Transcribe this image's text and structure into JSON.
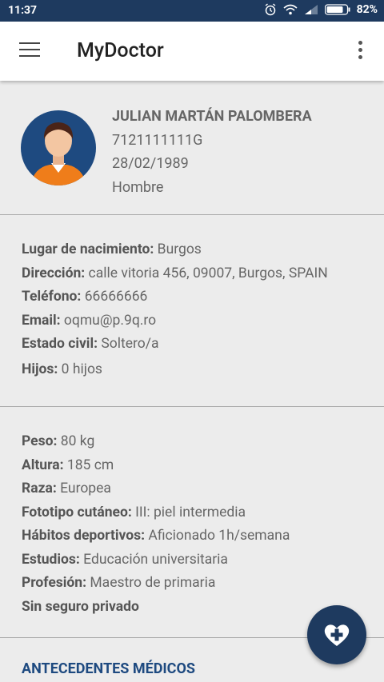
{
  "status_bar": {
    "time": "11:37",
    "battery": "82%"
  },
  "app_bar": {
    "title": "MyDoctor"
  },
  "profile": {
    "name": "JULIAN MARTÁN PALOMBERA",
    "id": "7121111111G",
    "birthdate": "28/02/1989",
    "gender": "Hombre"
  },
  "personal": {
    "birthplace_label": "Lugar de nacimiento:",
    "birthplace_value": " Burgos",
    "address_label": "Dirección:",
    "address_value": " calle vitoria 456, 09007, Burgos, SPAIN",
    "phone_label": "Teléfono:",
    "phone_value": " 66666666",
    "email_label": "Email:",
    "email_value": " oqmu@p.9q.ro",
    "civil_label": "Estado civil:",
    "civil_value": " Soltero/a",
    "children_label": "Hijos:",
    "children_value": " 0 hijos"
  },
  "health": {
    "weight_label": "Peso:",
    "weight_value": " 80 kg",
    "height_label": "Altura:",
    "height_value": " 185 cm",
    "race_label": "Raza:",
    "race_value": " Europea",
    "phototype_label": "Fototipo cutáneo:",
    "phototype_value": " III: piel intermedia",
    "sports_label": "Hábitos deportivos:",
    "sports_value": " Aficionado 1h/semana",
    "studies_label": "Estudios:",
    "studies_value": " Educación universitaria",
    "profession_label": "Profesión:",
    "profession_value": " Maestro de primaria",
    "insurance": "Sin seguro privado"
  },
  "antecedentes_title": "ANTECEDENTES MÉDICOS",
  "icons": {
    "menu": "hamburger-menu-icon",
    "more": "more-vert-icon",
    "fab": "heart-plus-icon",
    "alarm": "alarm-icon",
    "wifi": "wifi-icon",
    "signal": "signal-icon",
    "battery": "battery-icon"
  },
  "colors": {
    "primary": "#1e3a5f",
    "accent_text": "#1e4a80",
    "background": "#ececec"
  }
}
